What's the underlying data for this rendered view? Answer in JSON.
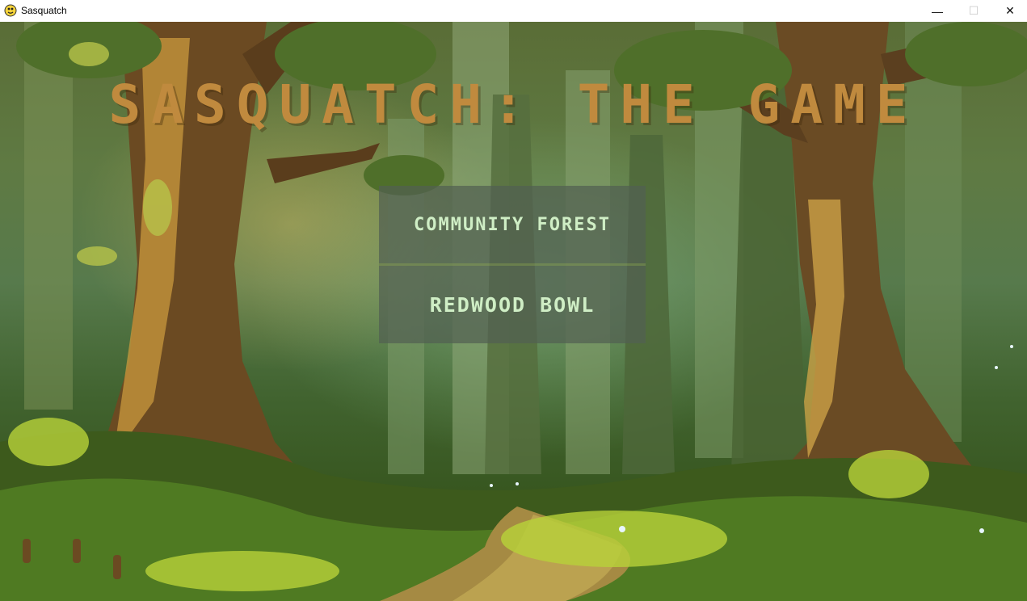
{
  "window": {
    "title": "Sasquatch",
    "minimize_glyph": "—",
    "maximize_glyph": "☐",
    "close_glyph": "✕"
  },
  "game": {
    "title": "SASQUATCH:  THE GAME"
  },
  "menu": {
    "options": [
      {
        "label": "COMMUNITY FOREST"
      },
      {
        "label": "REDWOOD BOWL"
      }
    ]
  },
  "colors": {
    "title_text": "#c08a3e",
    "menu_text": "#cfeec5",
    "menu_bg": "#526052"
  }
}
